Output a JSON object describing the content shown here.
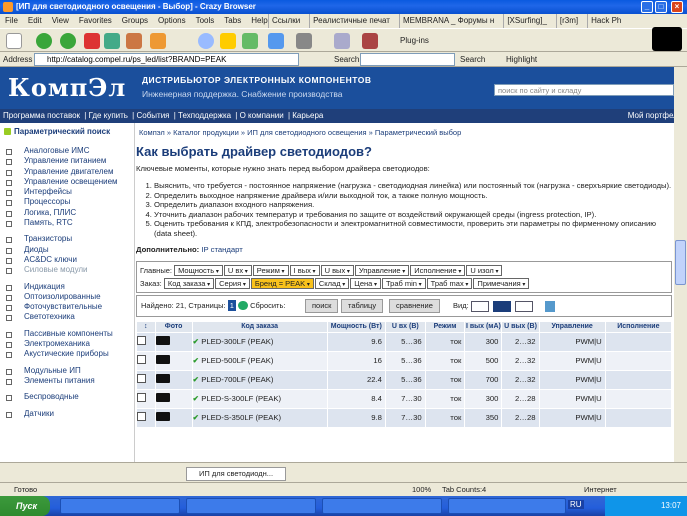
{
  "window": {
    "title": "[ИП для светодиодного освещения - Выбор] - Crazy Browser"
  },
  "menu": {
    "items": [
      "File",
      "Edit",
      "View",
      "Favorites",
      "Groups",
      "Options",
      "Tools",
      "Tabs",
      "Help"
    ],
    "tabs": [
      "Ссылки",
      "Реалистичные печат",
      "MEMBRANA _ Форумы н",
      "[XSurfing]_",
      "[r3m]",
      "Hack Ph"
    ]
  },
  "address": {
    "label": "Address",
    "url": "http://catalog.compel.ru/ps_led/list?BRAND=PEAK",
    "search_label": "Search",
    "search_btn": "Search",
    "highlight_btn": "Highlight",
    "plugins": "Plug-ins"
  },
  "banner": {
    "logo": "КомпЭл",
    "tagline1": "ДИСТРИБЬЮТОР ЭЛЕКТРОННЫХ КОМПОНЕНТОВ",
    "tagline2": "Инженерная поддержка. Снабжение производства",
    "search_placeholder": "поиск по сайту и складу"
  },
  "nav": {
    "items": [
      "Программа поставок",
      "Где купить",
      "События",
      "Техподдержка",
      "О компании",
      "Карьера"
    ],
    "portfolio": "Мой портфель"
  },
  "sidebar": {
    "head": "Параметрический поиск",
    "groups": [
      [
        "Аналоговые ИМС",
        "Управление питанием",
        "Управление двигателем",
        "Управление освещением",
        "Интерфейсы",
        "Процессоры",
        "Логика, ПЛИС",
        "Память, RTC"
      ],
      [
        "Транзисторы",
        "Диоды",
        "AC&DC ключи",
        "Силовые модули"
      ],
      [
        "Индикация",
        "Оптоизолированные",
        "Фоточувствительные",
        "Светотехника"
      ],
      [
        "Пассивные компоненты",
        "Электромеханика",
        "Акустические приборы"
      ],
      [
        "Модульные ИП",
        "Элементы питания"
      ],
      [
        "Беспроводные"
      ],
      [
        "Датчики"
      ]
    ]
  },
  "main": {
    "breadcrumb": "Компэл » Каталог продукции » ИП для светодиодного освещения » Параметрический выбор",
    "title": "Как выбрать драйвер светодиодов?",
    "intro": "Ключевые моменты, которые нужно знать перед выбором драйвера светодиодов:",
    "steps": [
      "Выяснить, что требуется - постоянное напряжение (нагрузка - светодиодная линейка) или постоянный ток (нагрузка - сверхъяркие светодиоды).",
      "Определить выходное напряжение драйвера и/или выходной ток, а также полную мощность.",
      "Определить диапазон входного напряжения.",
      "Уточнить диапазон рабочих температур и требования по защите от воздействий окружающей среды (ingress protection, IP).",
      "Оценить требования к КПД, электробезопасности и электромагнитной совместимости, проверить эти параметры по фирменному описанию (data sheet)."
    ],
    "extra_label": "Дополнительно:",
    "extra_link": "IP стандарт",
    "filters": {
      "main_label": "Главные:",
      "main": [
        "Мощность",
        "U вх",
        "Режим",
        "I вых",
        "U вых",
        "Управление",
        "Исполнение",
        "U изол"
      ],
      "order_label": "Заказ:",
      "order": [
        "Код заказа",
        "Серия",
        "Бренд = PEAK",
        "Склад",
        "Цена",
        "Траб min",
        "Траб max",
        "Примечания"
      ]
    },
    "results": {
      "found": "Найдено: 21, Страницы:",
      "page": "1",
      "reset": "Сбросить:",
      "search_btn": "поиск",
      "table_btn": "таблицу",
      "compare_btn": "сравнение",
      "view": "Вид:"
    },
    "table": {
      "headers": [
        "Фото",
        "Код заказа",
        "Мощность (Вт)",
        "U вх (В)",
        "Режим",
        "I вых (мА)",
        "U вых (В)",
        "Управление",
        "Исполнение"
      ],
      "rows": [
        {
          "code": "PLED-300LF (PEAK)",
          "power": "9.6",
          "uin": "5…36",
          "mode": "ток",
          "iout": "300",
          "uout": "2…32",
          "ctrl": "PWM|U"
        },
        {
          "code": "PLED-500LF (PEAK)",
          "power": "16",
          "uin": "5…36",
          "mode": "ток",
          "iout": "500",
          "uout": "2…32",
          "ctrl": "PWM|U"
        },
        {
          "code": "PLED-700LF (PEAK)",
          "power": "22.4",
          "uin": "5…36",
          "mode": "ток",
          "iout": "700",
          "uout": "2…32",
          "ctrl": "PWM|U"
        },
        {
          "code": "PLED-S-300LF (PEAK)",
          "power": "8.4",
          "uin": "7…30",
          "mode": "ток",
          "iout": "300",
          "uout": "2…28",
          "ctrl": "PWM|U"
        },
        {
          "code": "PLED-S-350LF (PEAK)",
          "power": "9.8",
          "uin": "7…30",
          "mode": "ток",
          "iout": "350",
          "uout": "2…28",
          "ctrl": "PWM|U"
        }
      ]
    }
  },
  "bottom_tab": "ИП для светодиодн...",
  "status": {
    "text": "Готово",
    "zoom": "100%",
    "tabcount": "Tab Counts:4",
    "zone": "Интернет"
  },
  "taskbar": {
    "start": "Пуск",
    "lang": "RU",
    "time": "13:07"
  }
}
